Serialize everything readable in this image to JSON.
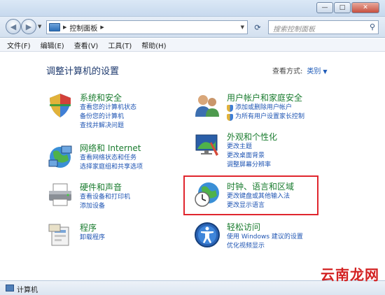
{
  "window": {
    "controls": {
      "minimize": "—",
      "maximize": "□",
      "close": "✕"
    }
  },
  "address": {
    "breadcrumb": [
      "控制面板"
    ],
    "search_placeholder": "搜索控制面板"
  },
  "menu": [
    "文件(F)",
    "编辑(E)",
    "查看(V)",
    "工具(T)",
    "帮助(H)"
  ],
  "header": {
    "title": "调整计算机的设置",
    "view_by_label": "查看方式:",
    "view_by_value": "类别"
  },
  "categories": [
    {
      "title": "系统和安全",
      "icon": "shield-icon",
      "links": [
        "查看您的计算机状态",
        "备份您的计算机",
        "查找并解决问题"
      ]
    },
    {
      "title": "网络和 Internet",
      "icon": "network-icon",
      "links": [
        "查看网络状态和任务",
        "选择家庭组和共享选项"
      ]
    },
    {
      "title": "硬件和声音",
      "icon": "printer-icon",
      "links": [
        "查看设备和打印机",
        "添加设备"
      ]
    },
    {
      "title": "程序",
      "icon": "programs-icon",
      "links": [
        "卸载程序"
      ]
    },
    {
      "title": "用户帐户和家庭安全",
      "icon": "users-icon",
      "links": [
        "添加或删除用户帐户",
        "为所有用户设置家长控制"
      ]
    },
    {
      "title": "外观和个性化",
      "icon": "appearance-icon",
      "links": [
        "更改主题",
        "更改桌面背景",
        "调整屏幕分辨率"
      ]
    },
    {
      "title": "时钟、语言和区域",
      "icon": "clock-globe-icon",
      "links": [
        "更改键盘或其他输入法",
        "更改显示语言"
      ]
    },
    {
      "title": "轻松访问",
      "icon": "ease-of-access-icon",
      "links": [
        "使用 Windows 建议的设置",
        "优化视频显示"
      ]
    }
  ],
  "status": {
    "text": "计算机"
  },
  "watermark": "云南龙网",
  "colors": {
    "category_title": "#1a7c2f",
    "link": "#1f55b3",
    "highlight": "#e0262e"
  }
}
